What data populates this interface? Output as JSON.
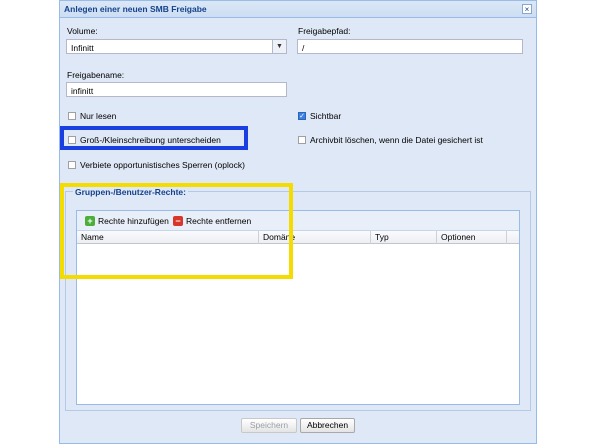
{
  "dialog": {
    "title": "Anlegen einer neuen SMB Freigabe",
    "close_symbol": "×"
  },
  "form": {
    "volume_label": "Volume:",
    "volume_value": "Infinitt",
    "path_label": "Freigabepfad:",
    "path_value": "/",
    "share_name_label": "Freigabename:",
    "share_name_value": "infinitt",
    "checkboxes": [
      {
        "label": "Nur lesen",
        "checked": false
      },
      {
        "label": "Sichtbar",
        "checked": true
      },
      {
        "label": "Groß-/Kleinschreibung unterscheiden",
        "checked": false
      },
      {
        "label": "Archivbit löschen, wenn die Datei gesichert ist",
        "checked": false
      },
      {
        "label": "Verbiete opportunistisches Sperren (oplock)",
        "checked": false
      }
    ]
  },
  "rights": {
    "legend": "Gruppen-/Benutzer-Rechte:",
    "add_label": "Rechte hinzufügen",
    "remove_label": "Rechte entfernen",
    "columns": [
      "Name",
      "Domäne",
      "Typ",
      "Optionen"
    ]
  },
  "footer": {
    "save_label": "Speichern",
    "cancel_label": "Abbrechen"
  },
  "colors": {
    "highlight_blue": "#1a3fe0",
    "highlight_yellow": "#f5dc00",
    "add_icon": "#4caf3a",
    "remove_icon": "#d9362b"
  }
}
